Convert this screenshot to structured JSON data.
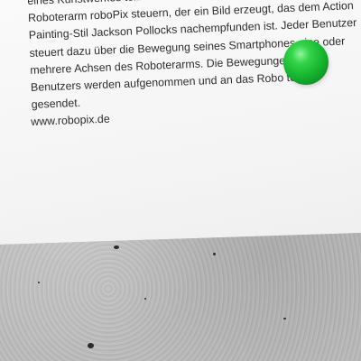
{
  "poster": {
    "lines": [
      "eines Kunstwerkes teilhaben. Maximal vier Benutzer",
      "Roboterarm roboPix steuern, der ein Bild erzeugt, das dem Action",
      "Painting-Stil Jackson Pollocks nachempfunden ist. Jeder Benutzer",
      "steuert dazu über die Bewegung seines Smartphones eine oder",
      "mehrere Achsen des Roboterarms. Die Bewegungen jedes",
      "Benutzers werden aufgenommen und an das Robo          tem",
      "gesendet."
    ],
    "website": "www.robopix.de"
  },
  "colors": {
    "ball": "#14b42e",
    "ground": "#b9b9b9",
    "text": "#2e2e2e"
  }
}
